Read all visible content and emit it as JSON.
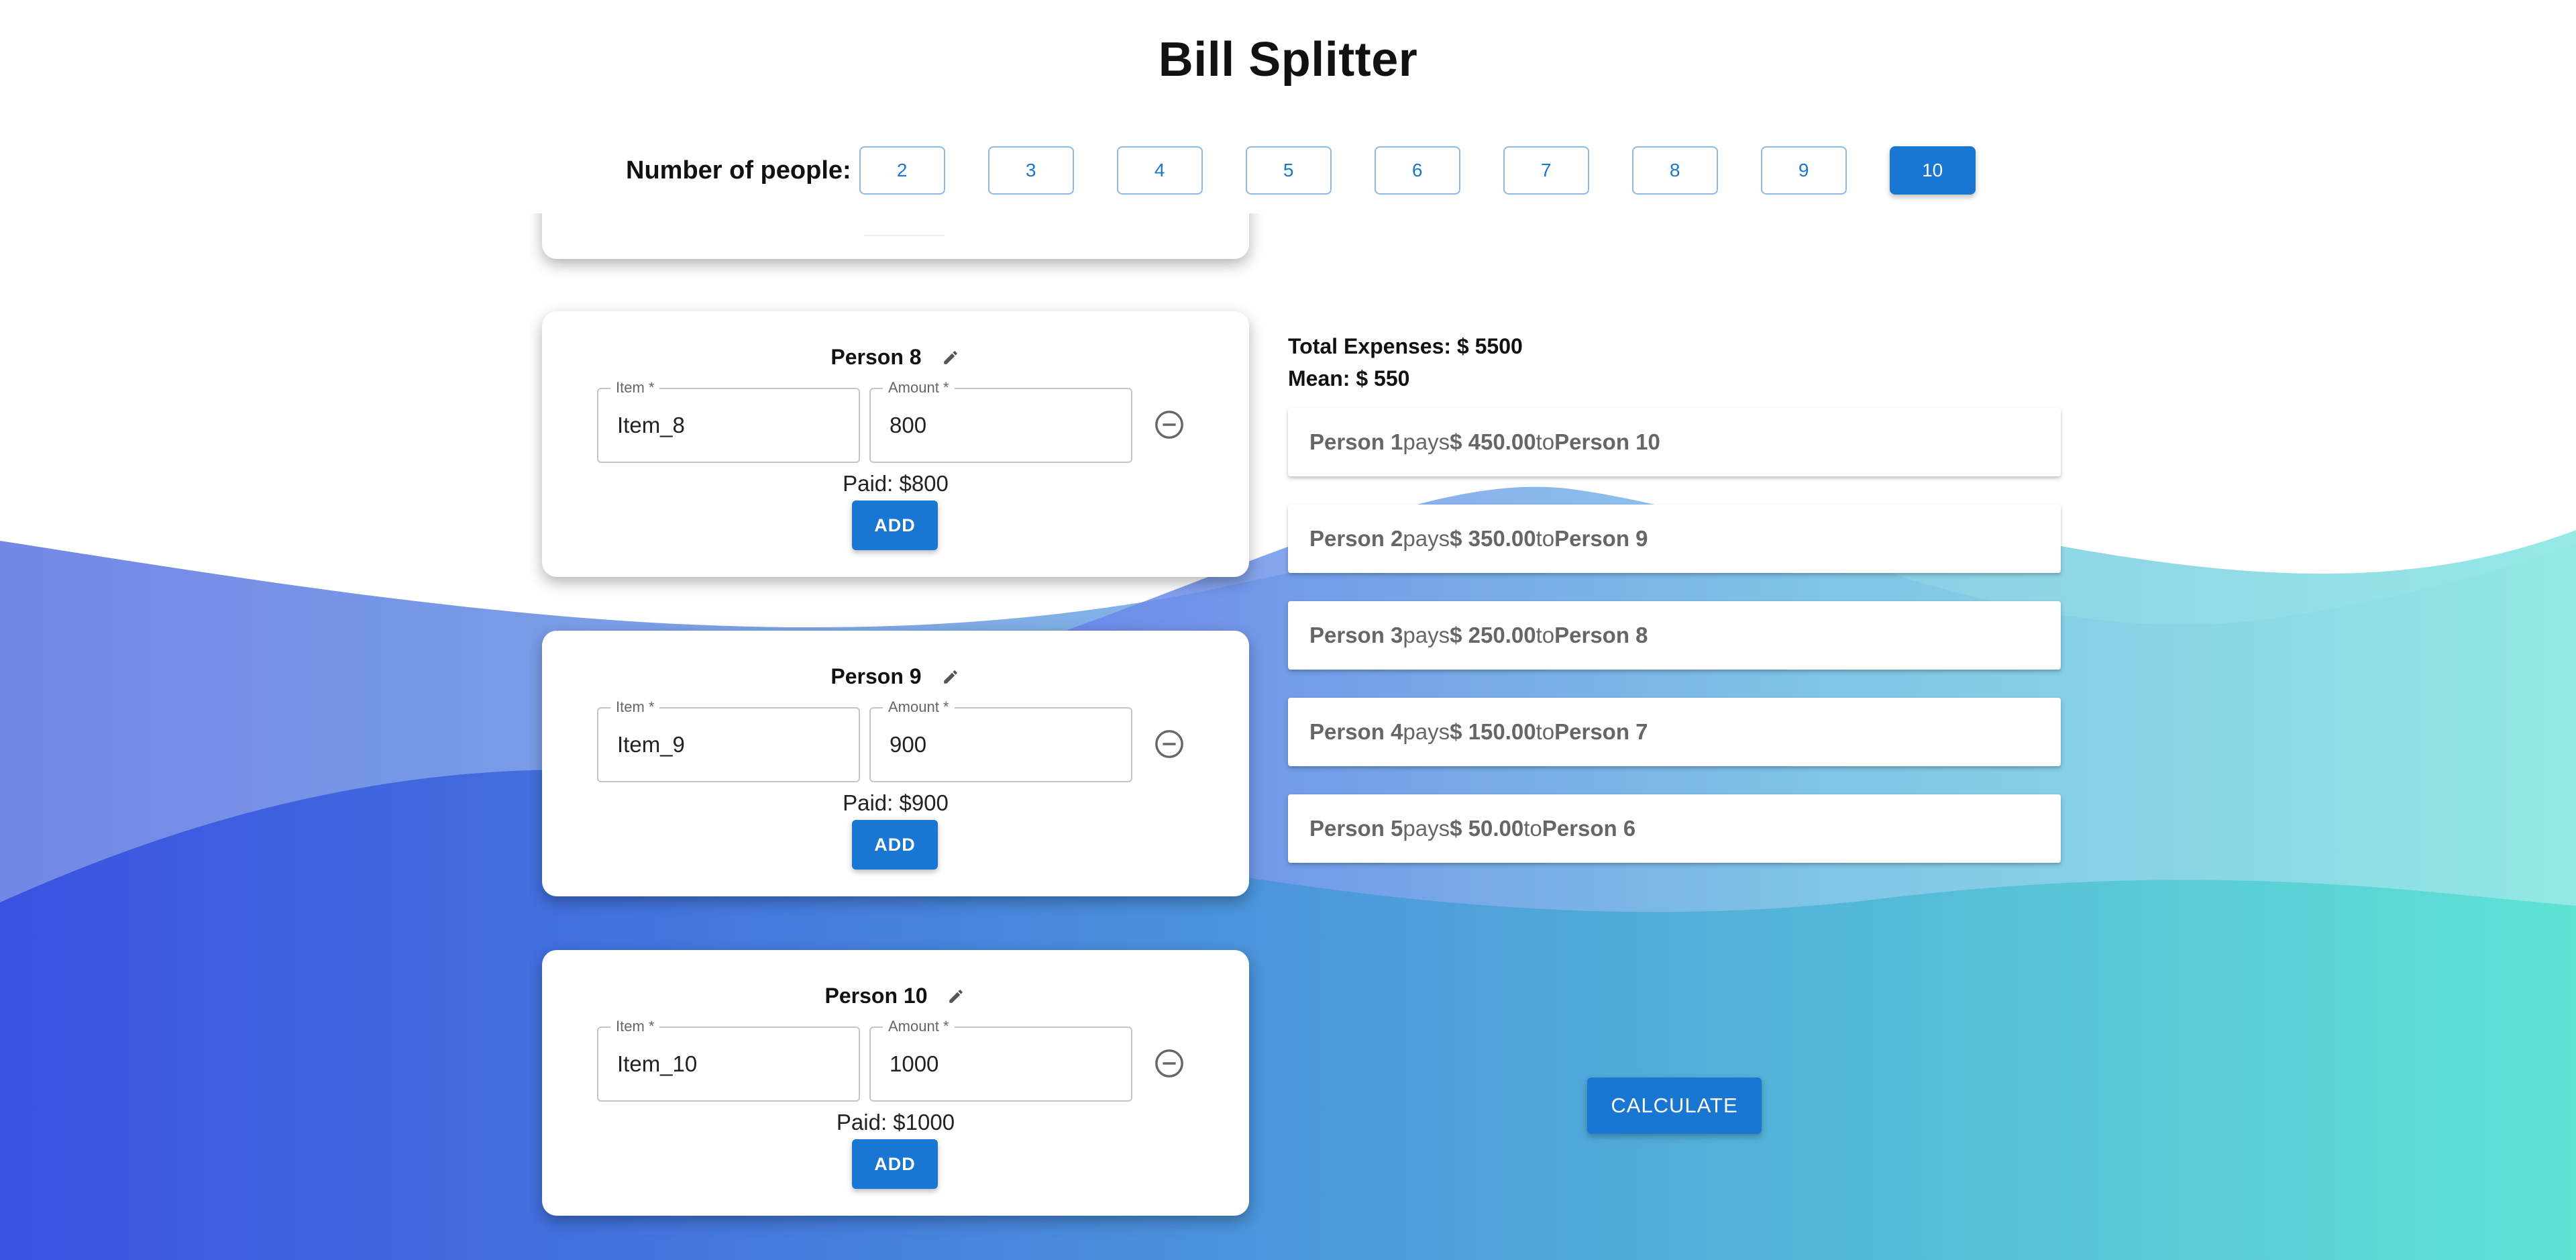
{
  "app": {
    "title": "Bill Splitter"
  },
  "people_selector": {
    "label": "Number of people:",
    "options": [
      "2",
      "3",
      "4",
      "5",
      "6",
      "7",
      "8",
      "9",
      "10"
    ],
    "selected": "10"
  },
  "persons": [
    {
      "name": "Person 8",
      "item_label": "Item *",
      "item_value": "Item_8",
      "amount_label": "Amount *",
      "amount_value": "800",
      "paid_text": "Paid: $800",
      "add_label": "ADD"
    },
    {
      "name": "Person 9",
      "item_label": "Item *",
      "item_value": "Item_9",
      "amount_label": "Amount *",
      "amount_value": "900",
      "paid_text": "Paid: $900",
      "add_label": "ADD"
    },
    {
      "name": "Person 10",
      "item_label": "Item *",
      "item_value": "Item_10",
      "amount_label": "Amount *",
      "amount_value": "1000",
      "paid_text": "Paid: $1000",
      "add_label": "ADD"
    }
  ],
  "summary": {
    "total_text": "Total Expenses: $ 5500",
    "mean_text": "Mean: $ 550"
  },
  "settlements": [
    {
      "from": "Person 1",
      "verb": "pays",
      "amount": "$ 450.00",
      "to_word": "to",
      "to": "Person 10"
    },
    {
      "from": "Person 2",
      "verb": "pays",
      "amount": "$ 350.00",
      "to_word": "to",
      "to": "Person 9"
    },
    {
      "from": "Person 3",
      "verb": "pays",
      "amount": "$ 250.00",
      "to_word": "to",
      "to": "Person 8"
    },
    {
      "from": "Person 4",
      "verb": "pays",
      "amount": "$ 150.00",
      "to_word": "to",
      "to": "Person 7"
    },
    {
      "from": "Person 5",
      "verb": "pays",
      "amount": "$ 50.00",
      "to_word": "to",
      "to": "Person 6"
    }
  ],
  "calculate_label": "CALCULATE",
  "colors": {
    "primary": "#1976d2",
    "wave_blue": "#3b55e0",
    "wave_teal": "#5ee3d6"
  },
  "icons": {
    "edit": "edit-icon",
    "remove": "remove-circle-icon"
  }
}
